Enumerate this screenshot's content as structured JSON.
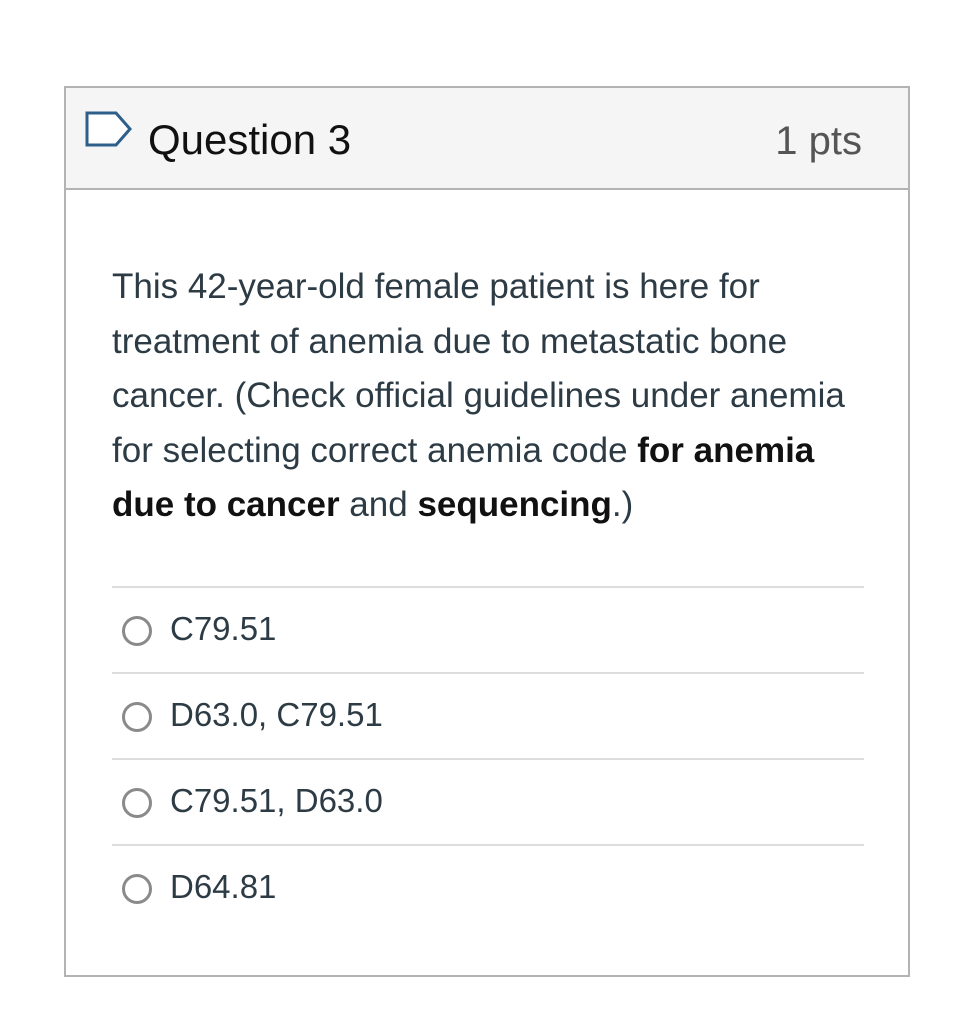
{
  "question": {
    "title": "Question 3",
    "points": "1 pts",
    "flag_icon": "bookmark-flag-icon",
    "text_parts": {
      "p1": "This 42-year-old female patient is here for treatment of anemia due to metastatic bone cancer. (Check official guidelines under anemia for selecting correct anemia code ",
      "b1": "for anemia due to cancer",
      "p2": " and ",
      "b2": "sequencing",
      "p3": ".)"
    },
    "answers": [
      {
        "label": "C79.51"
      },
      {
        "label": "D63.0, C79.51"
      },
      {
        "label": "C79.51, D63.0"
      },
      {
        "label": "D64.81"
      }
    ]
  },
  "colors": {
    "header_bg": "#f5f5f5",
    "border": "#b3b3b3",
    "flag_outline": "#2d5f8a",
    "text": "#2d3b45"
  }
}
